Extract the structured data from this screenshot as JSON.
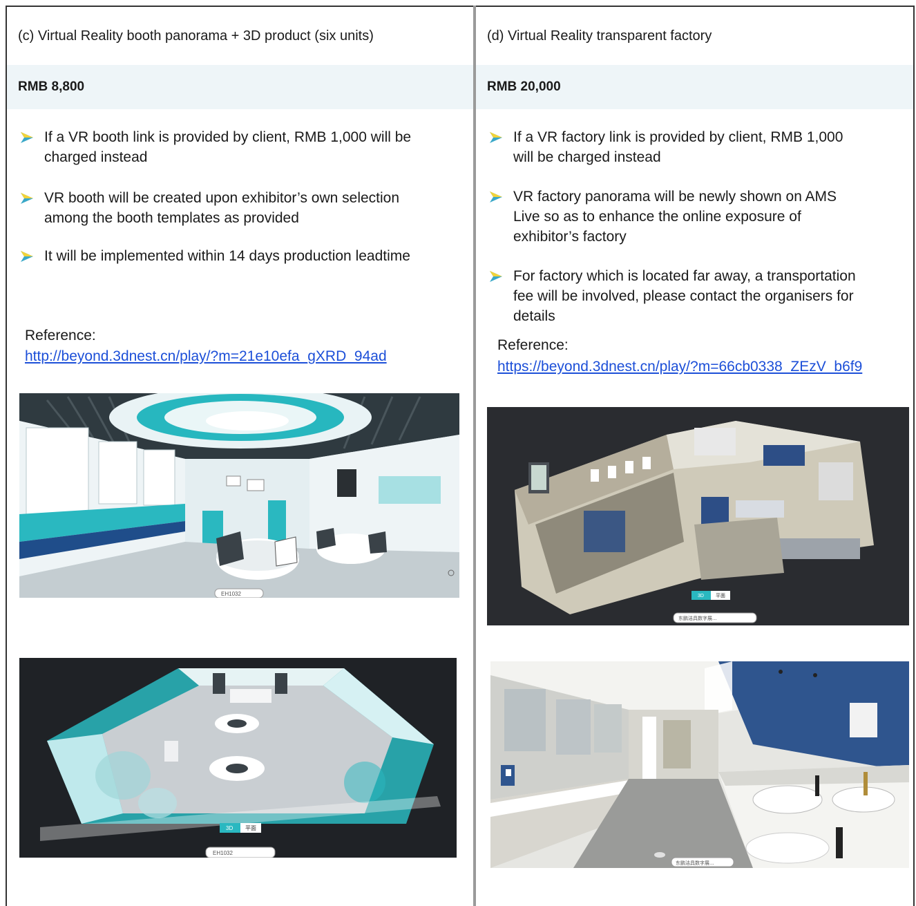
{
  "left": {
    "title": "(c) Virtual Reality booth panorama + 3D product (six units)",
    "price": "RMB 8,800",
    "bullets": [
      "If a VR booth link is provided by client, RMB 1,000 will be charged instead",
      "VR booth will be created upon exhibitor’s own selection among the booth templates as provided",
      "It will be implemented within 14 days production leadtime"
    ],
    "reference_label": "Reference:",
    "reference_link": "http://beyond.3dnest.cn/play/?m=21e10efa_gXRD_94ad",
    "image1_caption": "EH1032",
    "image2_caption": "EH1032",
    "image2_tabs": [
      "3D",
      "平面"
    ]
  },
  "right": {
    "title": "(d) Virtual Reality transparent factory",
    "price": "RMB 20,000",
    "bullets": [
      "If a VR factory link is provided by client, RMB 1,000 will be charged instead",
      "VR factory panorama will be newly shown on AMS Live so as to enhance the online exposure of exhibitor’s factory",
      "For factory which is located far away, a transportation fee will be involved, please contact the organisers for details"
    ],
    "reference_label": "Reference:",
    "reference_link": "https://beyond.3dnest.cn/play/?m=66cb0338_ZEzV_b6f9",
    "image1_tabs": [
      "3D",
      "平面"
    ],
    "image1_caption": "东鹏洁具数字展...",
    "image2_caption": "东鹏洁具数字展..."
  },
  "colors": {
    "accent": "#2ab8c0",
    "arrow": "#3aa8c8",
    "price_band": "#eef5f8",
    "link": "#1c4fd8"
  }
}
